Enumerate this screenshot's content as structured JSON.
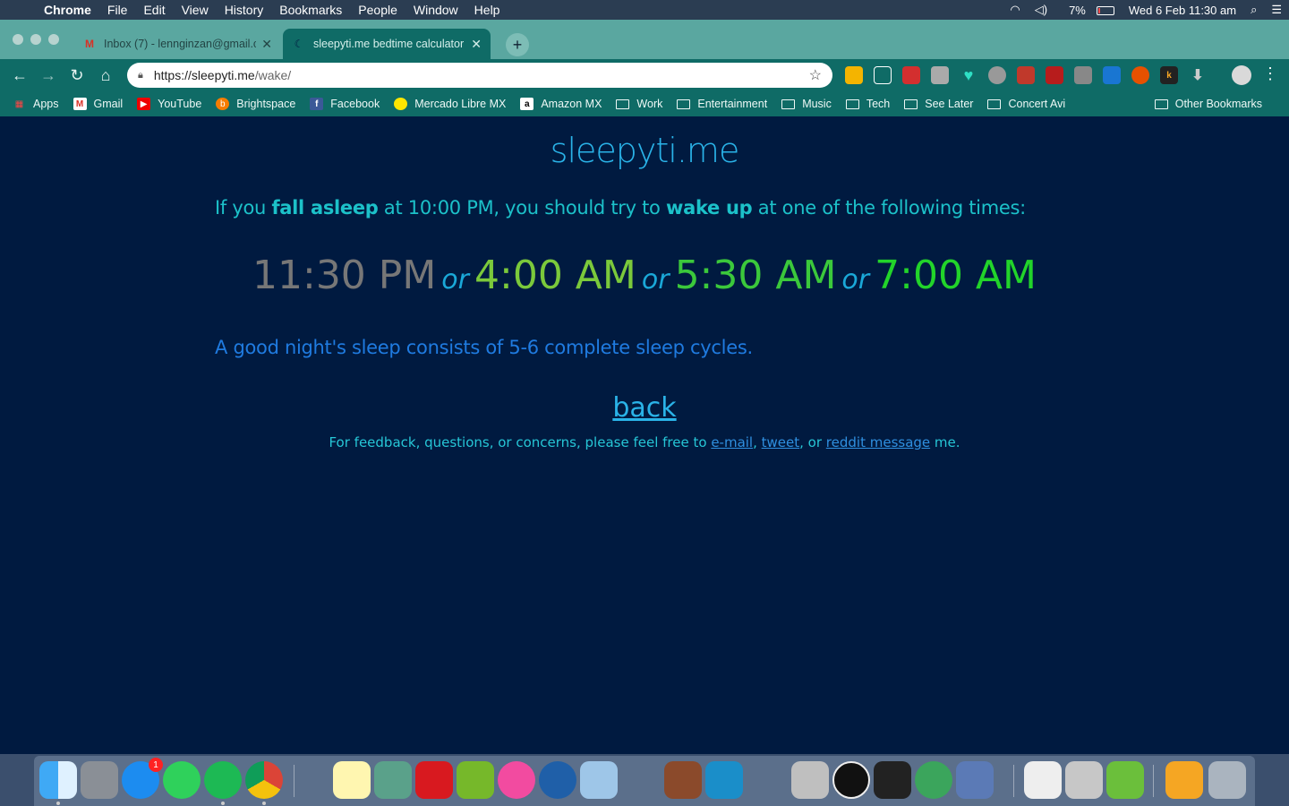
{
  "menubar": {
    "app_name": "Chrome",
    "menus": [
      "File",
      "Edit",
      "View",
      "History",
      "Bookmarks",
      "People",
      "Window",
      "Help"
    ],
    "battery_percent": "7%",
    "datetime": "Wed 6 Feb  11:30 am"
  },
  "tabs": [
    {
      "title": "Inbox (7) - lennginzan@gmail.c",
      "favicon": "gmail-icon",
      "active": false
    },
    {
      "title": "sleepyti.me bedtime calculator",
      "favicon": "moon-icon",
      "active": true
    }
  ],
  "toolbar": {
    "url_prefix": "https://sleepyti.me",
    "url_path": "/wake/"
  },
  "bookmarks": [
    {
      "label": "Apps",
      "icon": "apps-grid-icon"
    },
    {
      "label": "Gmail",
      "icon": "gmail-icon"
    },
    {
      "label": "YouTube",
      "icon": "youtube-icon"
    },
    {
      "label": "Brightspace",
      "icon": "brightspace-icon"
    },
    {
      "label": "Facebook",
      "icon": "facebook-icon"
    },
    {
      "label": "Mercado Libre MX",
      "icon": "mercadolibre-icon"
    },
    {
      "label": "Amazon MX",
      "icon": "amazon-icon"
    },
    {
      "label": "Work",
      "icon": "folder-icon"
    },
    {
      "label": "Entertainment",
      "icon": "folder-icon"
    },
    {
      "label": "Music",
      "icon": "folder-icon"
    },
    {
      "label": "Tech",
      "icon": "folder-icon"
    },
    {
      "label": "See Later",
      "icon": "folder-icon"
    },
    {
      "label": "Concert Avi",
      "icon": "folder-icon"
    }
  ],
  "other_bookmarks": "Other Bookmarks",
  "page": {
    "site_title": "sleepyti.me",
    "intro_1": "If you ",
    "intro_bold_1": "fall asleep",
    "intro_2": " at 10:00 PM, you should try to ",
    "intro_bold_2": "wake up",
    "intro_3": " at one of the following times:",
    "times": [
      "11:30 PM",
      "4:00 AM",
      "5:30 AM",
      "7:00 AM"
    ],
    "or_word": "or",
    "note": "A good night's sleep consists of 5-6 complete sleep cycles.",
    "back_link": "back",
    "feedback_1": "For feedback, questions, or concerns, please feel free to ",
    "feedback_email": "e-mail",
    "feedback_sep_1": ", ",
    "feedback_tweet": "tweet",
    "feedback_sep_2": ", or ",
    "feedback_reddit": "reddit message",
    "feedback_end": " me."
  },
  "dock": {
    "app_store_badge": "1"
  }
}
